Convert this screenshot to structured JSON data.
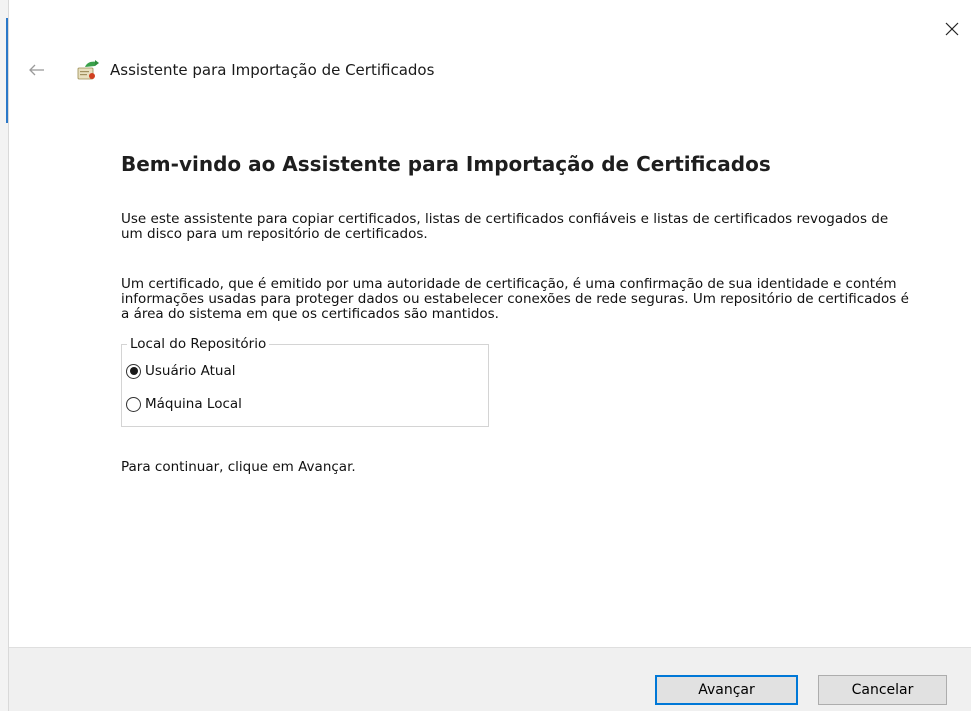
{
  "window": {
    "title": "Assistente para Importação de Certificados",
    "close_icon": "close-icon",
    "back_icon": "back-arrow-icon",
    "app_icon": "certificate-wizard-icon"
  },
  "main": {
    "heading": "Bem-vindo ao Assistente para Importação de Certificados",
    "intro": "Use este assistente para copiar certificados, listas de certificados confiáveis e listas de certificados revogados de um disco para um repositório de certificados.",
    "description": "Um certificado, que é emitido por uma autoridade de certificação, é uma confirmação de sua identidade e contém informações usadas para proteger dados ou estabelecer conexões de rede seguras. Um repositório de certificados é a área do sistema em que os certificados são mantidos.",
    "store_location": {
      "legend": "Local do Repositório",
      "options": [
        {
          "label": "Usuário Atual",
          "selected": true
        },
        {
          "label": "Máquina Local",
          "selected": false
        }
      ]
    },
    "continue_hint": "Para continuar, clique em Avançar."
  },
  "footer": {
    "next_label": "Avançar",
    "cancel_label": "Cancelar"
  },
  "colors": {
    "focus_border": "#0078d7",
    "footer_bg": "#f0f0f0",
    "button_bg": "#e1e1e1"
  }
}
